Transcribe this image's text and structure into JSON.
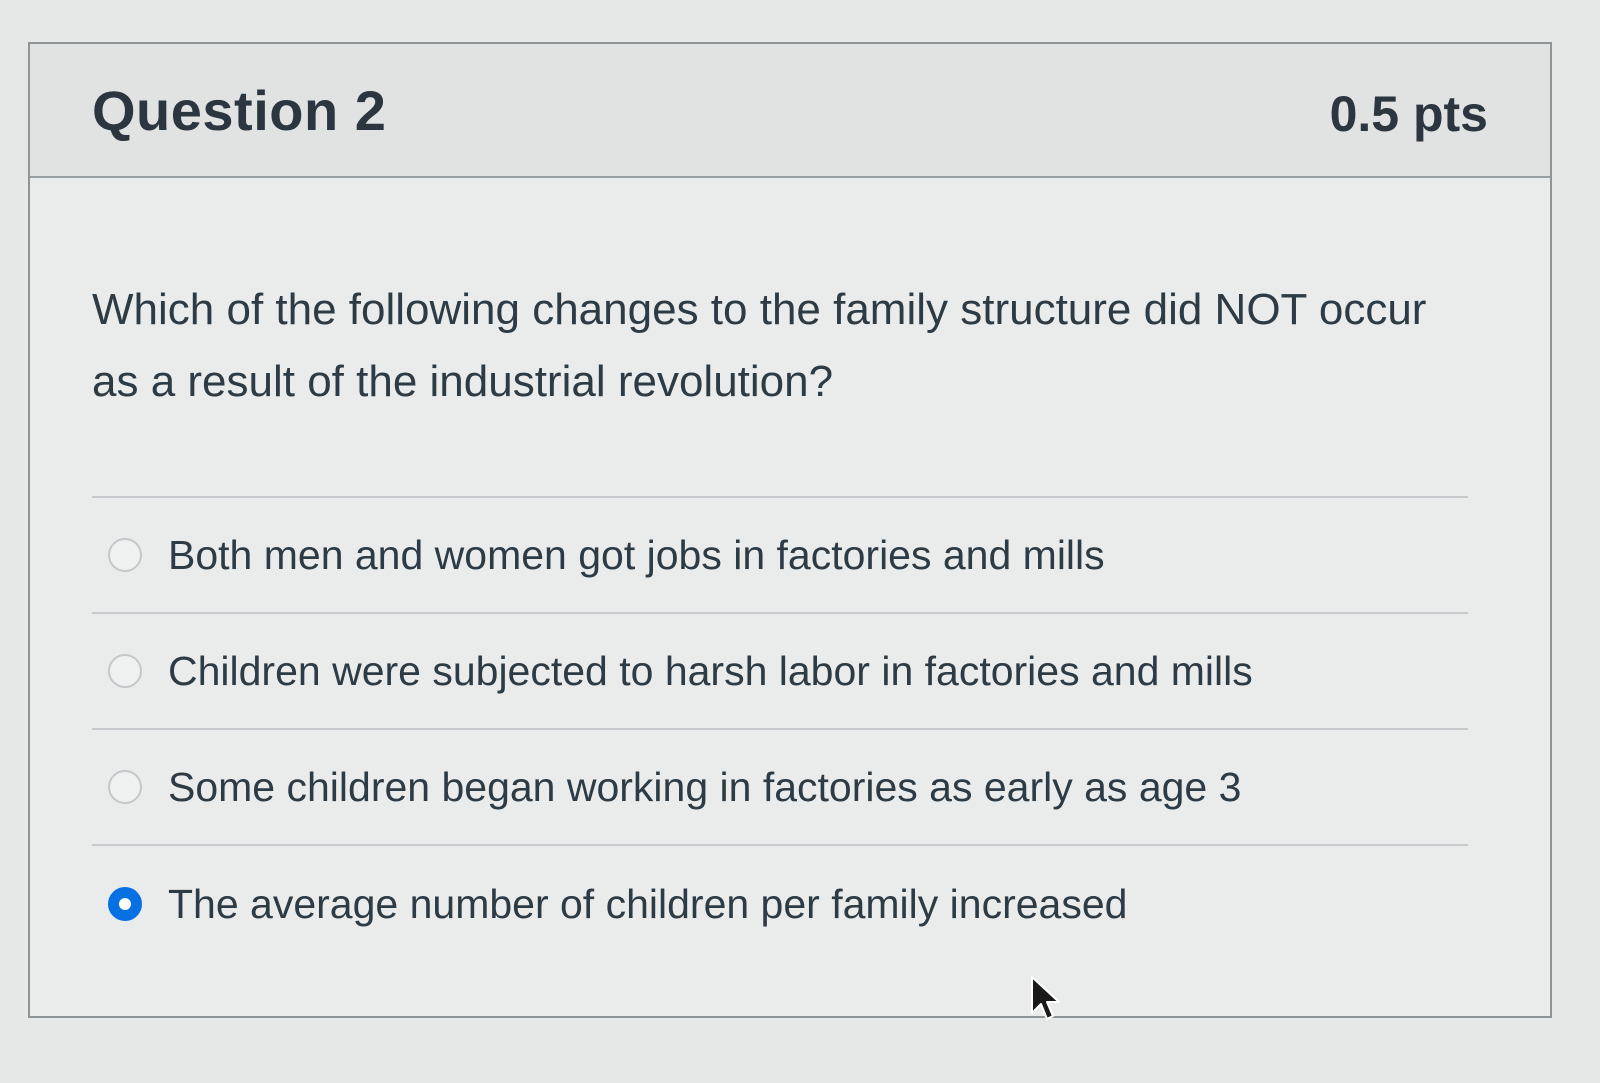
{
  "question": {
    "title": "Question 2",
    "points": "0.5 pts",
    "text": "Which of the following changes to the family structure did NOT occur as a result of the industrial revolution?"
  },
  "answers": [
    {
      "label": "Both men and women got jobs in factories and mills",
      "selected": false
    },
    {
      "label": "Children were subjected to harsh labor in factories and mills",
      "selected": false
    },
    {
      "label": "Some children began working in factories as early as age 3",
      "selected": false
    },
    {
      "label": "The average number of children per family increased",
      "selected": true
    }
  ],
  "colors": {
    "accent": "#0770e3",
    "text": "#2d3b45",
    "border": "#8f9497"
  },
  "icons": {
    "cursor": "mouse-pointer-icon",
    "radio": "radio-button-icon"
  }
}
